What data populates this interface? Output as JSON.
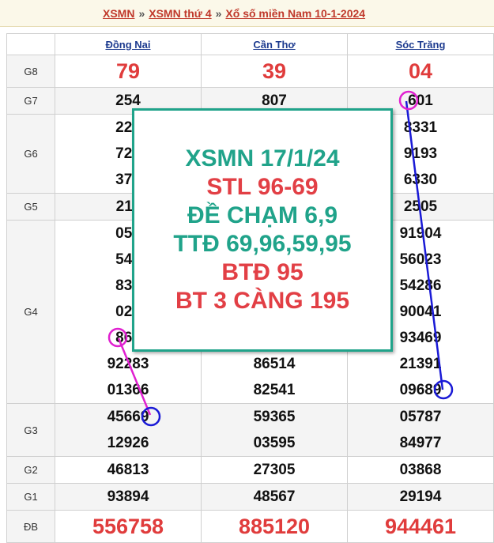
{
  "breadcrumb": {
    "home": "XSMN",
    "sep": "»",
    "day": "XSMN thứ 4",
    "current": "Xổ số miền Nam 10-1-2024"
  },
  "table": {
    "provinces": [
      "Đồng Nai",
      "Cần Thơ",
      "Sóc Trăng"
    ],
    "rows": [
      {
        "prize": "G8",
        "values": [
          [
            "79"
          ],
          [
            "39"
          ],
          [
            "04"
          ]
        ]
      },
      {
        "prize": "G7",
        "values": [
          [
            "254"
          ],
          [
            "807"
          ],
          [
            "601"
          ]
        ]
      },
      {
        "prize": "G6",
        "values": [
          [
            "221"
          ],
          [
            "720"
          ],
          [
            "373"
          ]
        ],
        "v2": [
          [
            "8331"
          ],
          [
            "9193"
          ],
          [
            "6330"
          ]
        ]
      },
      {
        "prize": "G5",
        "values": [
          [
            "211"
          ],
          [
            ""
          ],
          [
            "2505"
          ]
        ]
      },
      {
        "prize": "G4"
      },
      {
        "prize": "G3"
      },
      {
        "prize": "G2",
        "values": [
          [
            "46813"
          ],
          [
            "27305"
          ],
          [
            "03868"
          ]
        ]
      },
      {
        "prize": "G1",
        "values": [
          [
            "93894"
          ],
          [
            "48567"
          ],
          [
            "29194"
          ]
        ]
      },
      {
        "prize": "ĐB",
        "values": [
          [
            "556758"
          ],
          [
            "885120"
          ],
          [
            "944461"
          ]
        ]
      }
    ],
    "g6": {
      "c1": [
        "221",
        "720",
        "373"
      ],
      "c2": [
        "",
        "",
        ""
      ],
      "c3": [
        "8331",
        "9193",
        "6330"
      ]
    },
    "g4": {
      "c1": [
        "058",
        "543",
        "838",
        "021",
        "868",
        "92283",
        "01366"
      ],
      "c2": [
        "",
        "",
        "",
        "",
        "",
        "86514",
        "82541"
      ],
      "c3": [
        "91904",
        "56023",
        "54286",
        "90041",
        "93469",
        "21391",
        "09689"
      ]
    },
    "g3": {
      "c1": [
        "45669",
        "12926"
      ],
      "c2": [
        "59365",
        "03595"
      ],
      "c3": [
        "05787",
        "84977"
      ]
    }
  },
  "overlay": {
    "lines": [
      "XSMN 17/1/24",
      "STL 96-69",
      "ĐỀ CHẠM 6,9",
      "TTĐ 69,96,59,95",
      "BTĐ 95",
      "BT 3 CÀNG 195"
    ],
    "teal": "#20a38a",
    "red": "#e23f45"
  },
  "colors": {
    "accent_red": "#e03c3c",
    "link_blue": "#1d3b8f",
    "mark_blue": "#1a1ad6",
    "mark_magenta": "#e020d0"
  }
}
